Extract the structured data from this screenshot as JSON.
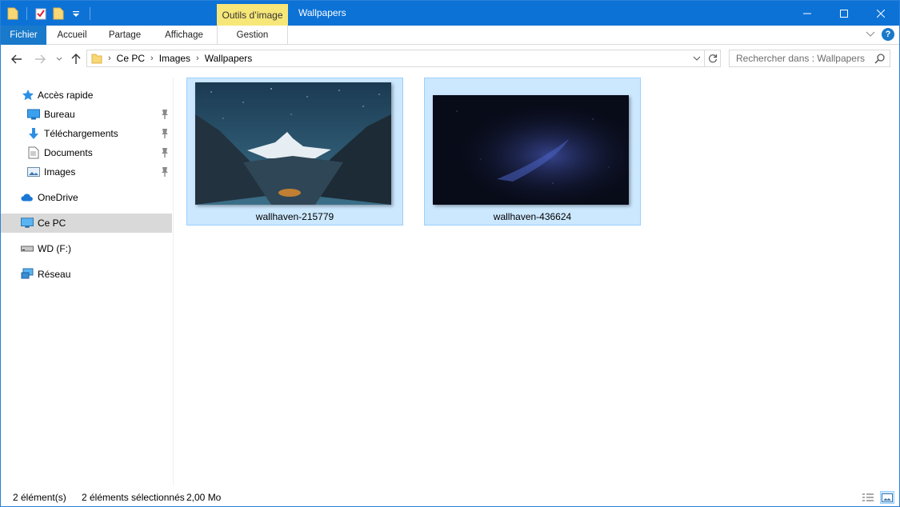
{
  "titlebar": {
    "context_tab": "Outils d’image",
    "title": "Wallpapers"
  },
  "ribbon": {
    "tabs": [
      {
        "label": "Fichier"
      },
      {
        "label": "Accueil"
      },
      {
        "label": "Partage"
      },
      {
        "label": "Affichage"
      },
      {
        "label": "Gestion"
      }
    ],
    "help_label": "?"
  },
  "address": {
    "crumbs": [
      "Ce PC",
      "Images",
      "Wallpapers"
    ]
  },
  "search": {
    "placeholder": "Rechercher dans : Wallpapers"
  },
  "sidebar": {
    "items": [
      {
        "label": "Accès rapide",
        "icon": "star-icon"
      },
      {
        "label": "Bureau",
        "icon": "desktop-icon",
        "pinned": true
      },
      {
        "label": "Téléchargements",
        "icon": "download-icon",
        "pinned": true
      },
      {
        "label": "Documents",
        "icon": "documents-icon",
        "pinned": true
      },
      {
        "label": "Images",
        "icon": "pictures-icon",
        "pinned": true
      },
      {
        "label": "OneDrive",
        "icon": "cloud-icon"
      },
      {
        "label": "Ce PC",
        "icon": "computer-icon",
        "selected": true
      },
      {
        "label": "WD (F:)",
        "icon": "drive-icon"
      },
      {
        "label": "Réseau",
        "icon": "network-icon"
      }
    ]
  },
  "files": [
    {
      "name": "wallhaven-215779",
      "selected": true
    },
    {
      "name": "wallhaven-436624",
      "selected": true
    }
  ],
  "status": {
    "count": "2 élément(s)",
    "selection": "2 éléments sélectionnés",
    "size": "2,00 Mo"
  },
  "colors": {
    "titlebar": "#0c72d6",
    "file_tab": "#1979ca",
    "context_tab": "#f7e778",
    "selection": "#cce8ff",
    "selection_border": "#99d1ff"
  }
}
